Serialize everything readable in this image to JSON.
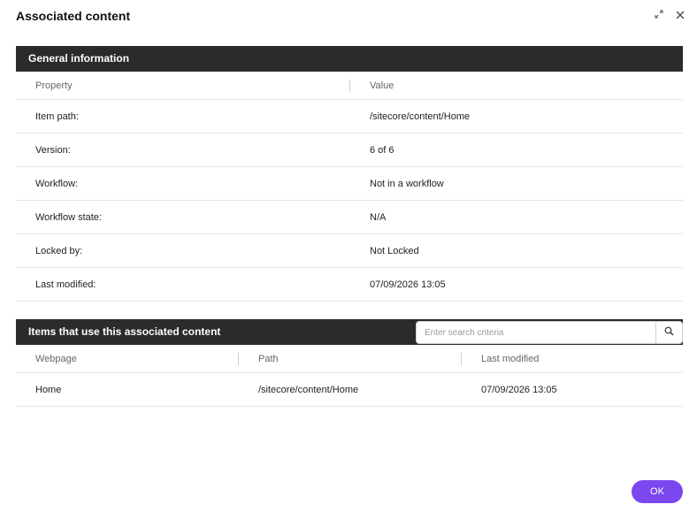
{
  "dialog": {
    "title": "Associated content",
    "icons": [
      "expand-icon",
      "close-icon"
    ]
  },
  "general": {
    "heading": "General information",
    "columns": {
      "property": "Property",
      "value": "Value"
    },
    "rows": [
      {
        "property": "Item path:",
        "value": "/sitecore/content/Home"
      },
      {
        "property": "Version:",
        "value": "6 of 6"
      },
      {
        "property": "Workflow:",
        "value": "Not in a workflow"
      },
      {
        "property": "Workflow state:",
        "value": "N/A"
      },
      {
        "property": "Locked by:",
        "value": "Not Locked"
      },
      {
        "property": "Last modified:",
        "value": "07/09/2026 13:05"
      }
    ]
  },
  "items": {
    "heading": "Items that use this associated content",
    "search_placeholder": "Enter search criteria",
    "columns": {
      "webpage": "Webpage",
      "path": "Path",
      "last_modified": "Last modified"
    },
    "rows": [
      {
        "webpage": "Home",
        "path": "/sitecore/content/Home",
        "last_modified": "07/09/2026 13:05"
      }
    ]
  },
  "footer": {
    "ok_label": "OK"
  },
  "colors": {
    "header_bar": "#2b2b2b",
    "primary": "#7b48f0"
  }
}
